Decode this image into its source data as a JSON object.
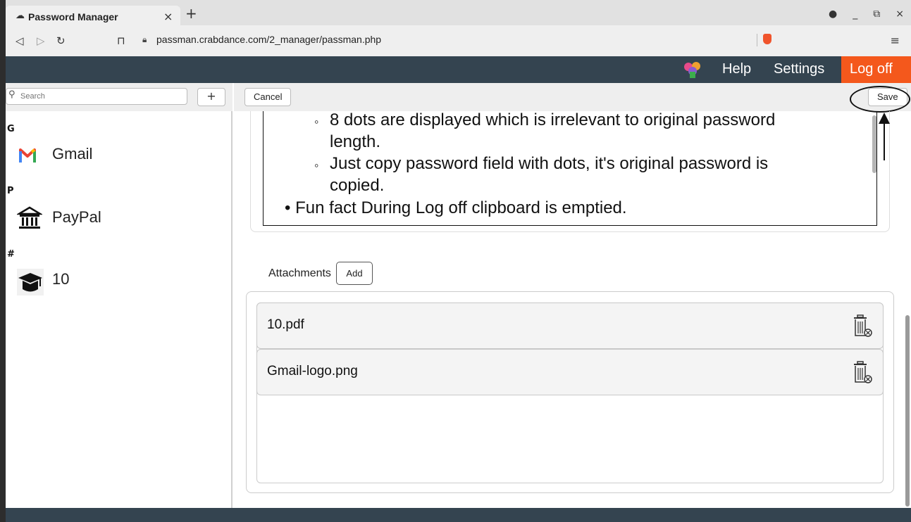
{
  "browser": {
    "tab_title": "Password Manager",
    "tab_close": "×",
    "new_tab": "+",
    "url": "passman.crabdance.com/2_manager/passman.php",
    "win_minimize": "_",
    "win_restore": "⧉",
    "win_close": "×",
    "menu": "≡"
  },
  "header": {
    "help": "Help",
    "settings": "Settings",
    "logoff": "Log off",
    "colors": {
      "bar": "#344450",
      "logoff": "#f4581c"
    }
  },
  "sidebar": {
    "search_placeholder": "Search",
    "add_label": "+",
    "groups": [
      {
        "letter": "G",
        "entries": [
          {
            "label": "Gmail",
            "icon": "gmail-icon"
          }
        ]
      },
      {
        "letter": "P",
        "entries": [
          {
            "label": "PayPal",
            "icon": "bank-icon"
          }
        ]
      },
      {
        "letter": "#",
        "entries": [
          {
            "label": "10",
            "icon": "graduation-cap-icon"
          }
        ]
      }
    ]
  },
  "toolbar": {
    "cancel_label": "Cancel",
    "save_label": "Save"
  },
  "notes": {
    "sub_items": [
      {
        "bullet": "◦",
        "lines": [
          "8 dots are displayed which is irrelevant to original password",
          "length."
        ]
      },
      {
        "bullet": "◦",
        "lines": [
          "Just copy password field with dots, it's original password is",
          "copied."
        ]
      }
    ],
    "main_items": [
      {
        "bullet": "•",
        "text": "Fun fact During Log off clipboard is emptied."
      }
    ]
  },
  "attachments": {
    "label": "Attachments",
    "add_label": "Add",
    "files": [
      {
        "name": "10.pdf"
      },
      {
        "name": "Gmail-logo.png"
      }
    ]
  }
}
